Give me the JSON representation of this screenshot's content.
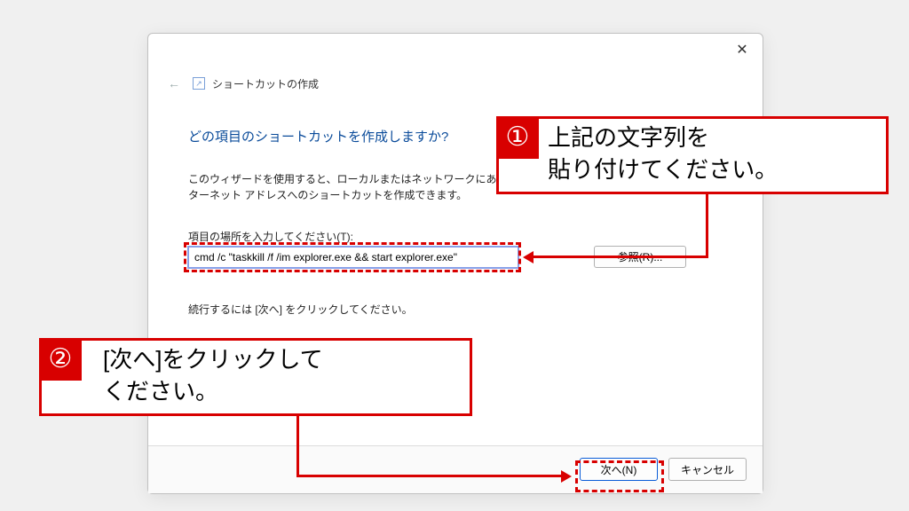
{
  "dialog": {
    "title": "ショートカットの作成",
    "heading": "どの項目のショートカットを作成しますか?",
    "desc_line1": "このウィザードを使用すると、ローカルまたはネットワークにある",
    "desc_line2": "ターネット アドレスへのショートカットを作成できます。",
    "input_label": "項目の場所を入力してください(T):",
    "input_value": "cmd /c \"taskkill /f /im explorer.exe && start explorer.exe\"",
    "browse_label": "参照(R)...",
    "continue_text": "続行するには [次へ] をクリックしてください。",
    "next_label": "次へ(N)",
    "cancel_label": "キャンセル"
  },
  "callouts": {
    "one": {
      "num": "①",
      "line1": "上記の文字列を",
      "line2": "貼り付けてください。"
    },
    "two": {
      "num": "②",
      "line1": "[次へ]をクリックして",
      "line2": "ください。"
    }
  }
}
